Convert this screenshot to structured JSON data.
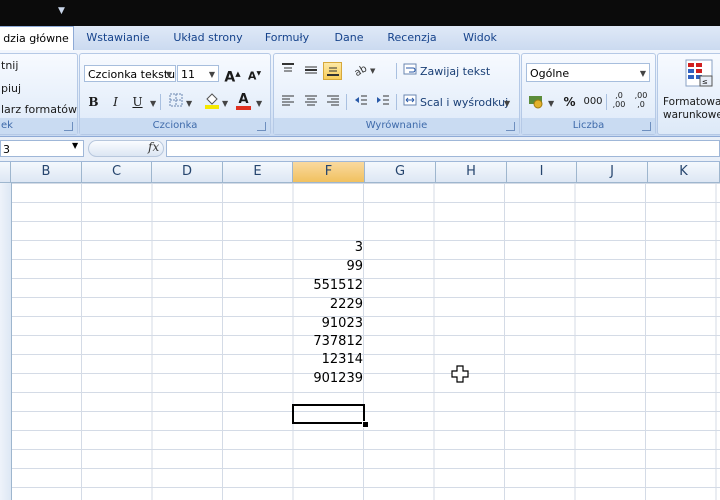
{
  "ribbon_tabs": [
    {
      "label": "dzia główne"
    },
    {
      "label": "Wstawianie"
    },
    {
      "label": "Układ strony"
    },
    {
      "label": "Formuły"
    },
    {
      "label": "Dane"
    },
    {
      "label": "Recenzja"
    },
    {
      "label": "Widok"
    }
  ],
  "clipboard": {
    "cut": "tnij",
    "copy": "piuj",
    "painter": "larz formatów",
    "label": "ek"
  },
  "font_group": {
    "font_name": "Czcionka tekstu",
    "font_size": "11",
    "label": "Czcionka",
    "bold": "B",
    "italic": "I",
    "underline": "U",
    "grow": "A",
    "shrink": "A",
    "color_a": "A"
  },
  "alignment_group": {
    "wrap_text": "Zawijaj tekst",
    "merge_center": "Scal i wyśrodkuj",
    "label": "Wyrównanie"
  },
  "number_group": {
    "format": "Ogólne",
    "label": "Liczba",
    "percent": "%",
    "thousands": "000",
    "inc_dec": ",0\n,00",
    "dec_dec": ",00\n,0"
  },
  "styles_group": {
    "conditional_line1": "Formatowa",
    "conditional_line2": "warunkowe"
  },
  "name_box": {
    "value": "3"
  },
  "fx_symbol": "fx",
  "columns": [
    "B",
    "C",
    "D",
    "E",
    "F",
    "G",
    "H",
    "I",
    "J",
    "K"
  ],
  "selected_column": "F",
  "cells_F": [
    "3",
    "99",
    "551512",
    "2229",
    "91023",
    "737812",
    "12314",
    "901239"
  ],
  "colors": {
    "accent": "#15428b",
    "selected_header": "#f1c15f",
    "font_color_bar": "#e03020",
    "fill_bar": "#f5e800"
  }
}
